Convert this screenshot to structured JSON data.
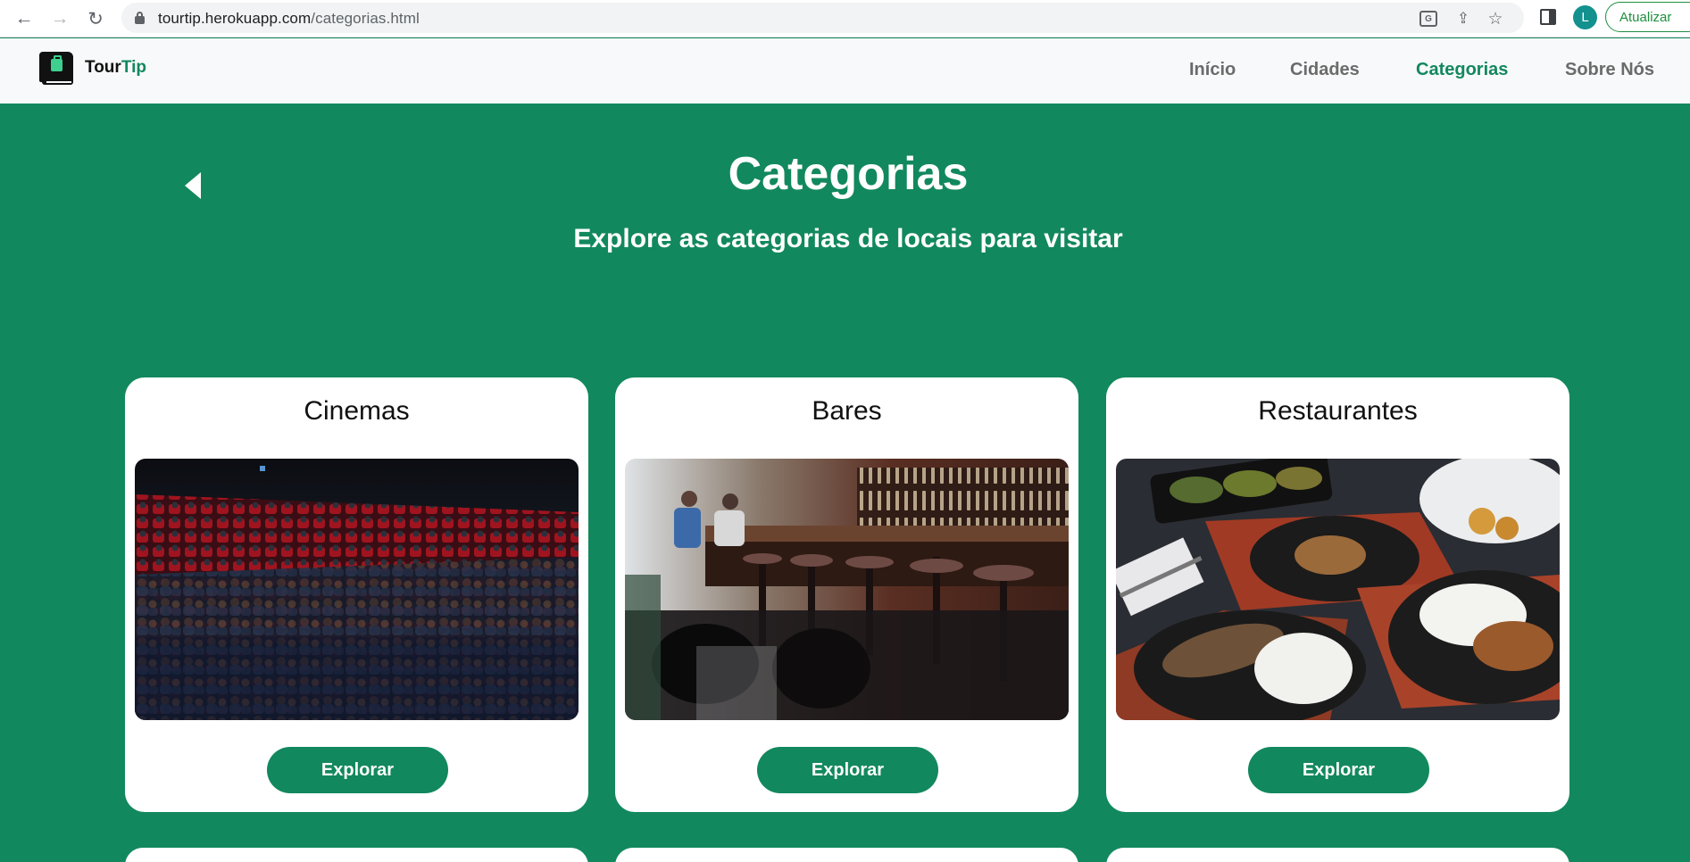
{
  "browser": {
    "url_host": "tourtip.herokuapp.com",
    "url_path": "/categorias.html",
    "avatar_letter": "L",
    "update_label": "Atualizar"
  },
  "site": {
    "logo_part1": "Tour",
    "logo_part2": "Tip",
    "nav": [
      {
        "label": "Início"
      },
      {
        "label": "Cidades"
      },
      {
        "label": "Categorias",
        "active": true
      },
      {
        "label": "Sobre Nós"
      }
    ]
  },
  "hero": {
    "title": "Categorias",
    "subtitle": "Explore as categorias de locais para visitar"
  },
  "cards": [
    {
      "title": "Cinemas",
      "button": "Explorar"
    },
    {
      "title": "Bares",
      "button": "Explorar"
    },
    {
      "title": "Restaurantes",
      "button": "Explorar"
    }
  ],
  "colors": {
    "brand_green": "#12885e",
    "nav_active": "#12885e",
    "nav_inactive": "#6b6b6b"
  }
}
